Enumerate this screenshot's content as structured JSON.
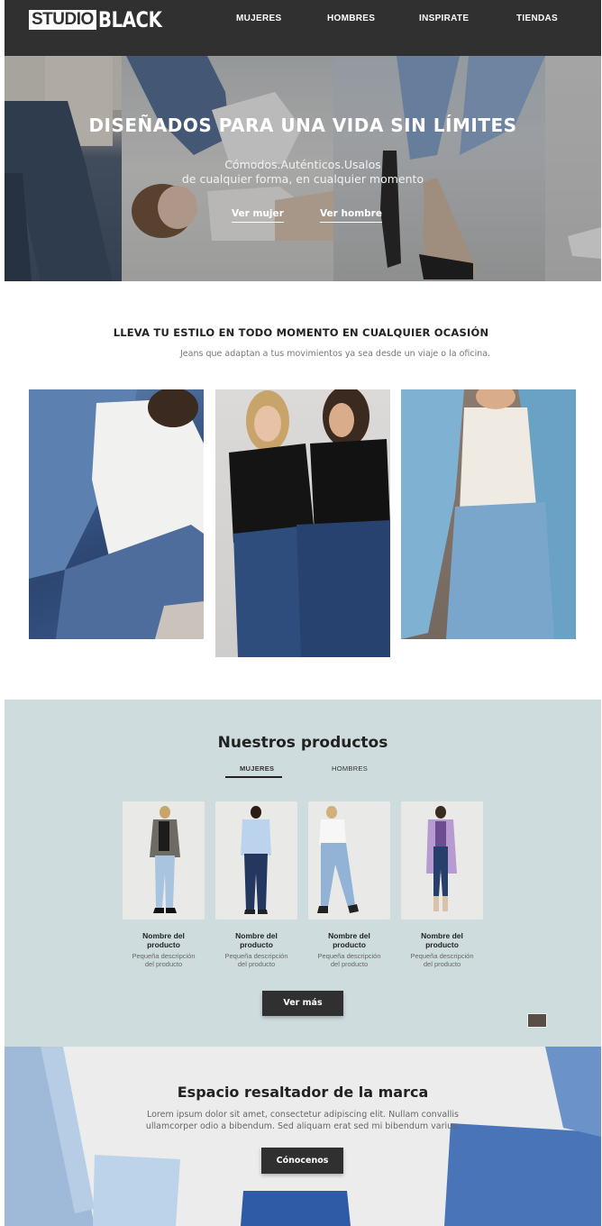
{
  "header": {
    "logo_boxed": "STUDIO",
    "logo_text": "BLACK",
    "nav": [
      "MUJERES",
      "HOMBRES",
      "INSPIRATE",
      "TIENDAS"
    ]
  },
  "hero": {
    "title": "DISEÑADOS PARA UNA VIDA SIN LÍMITES",
    "subtitle_line1": "Cómodos.Auténticos.Usalos",
    "subtitle_line2": "de cualquier forma, en cualquier momento",
    "link_women": "Ver mujer",
    "link_men": "Ver hombre"
  },
  "style": {
    "title": "LLEVA TU ESTILO EN TODO MOMENTO EN CUALQUIER OCASIÓN",
    "subtitle": "Jeans que adaptan a tus movimientos ya sea desde un viaje o la oficina."
  },
  "products": {
    "title": "Nuestros productos",
    "tabs": [
      "MUJERES",
      "HOMBRES"
    ],
    "active_tab": "MUJERES",
    "items": [
      {
        "name_line1": "Nombre del",
        "name_line2": "producto",
        "desc_line1": "Pequeña descripción",
        "desc_line2": "del producto"
      },
      {
        "name_line1": "Nombre del",
        "name_line2": "producto",
        "desc_line1": "Pequeña descripción",
        "desc_line2": "del producto"
      },
      {
        "name_line1": "Nombre del",
        "name_line2": "producto",
        "desc_line1": "Pequeña descripción",
        "desc_line2": "del producto"
      },
      {
        "name_line1": "Nombre del",
        "name_line2": "producto",
        "desc_line1": "Pequeña descripción",
        "desc_line2": "del producto"
      }
    ],
    "more_button": "Ver más"
  },
  "brand": {
    "title": "Espacio resaltador de la marca",
    "text": "Lorem ipsum dolor sit amet, consectetur adipiscing elit. Nullam convallis ullamcorper odio a bibendum. Sed aliquam erat sed mi bibendum varius.",
    "button": "Cónocenos"
  },
  "colors": {
    "header_bg": "#303030",
    "products_bg": "#cfdcdd",
    "brand_bg": "#ececed",
    "button_bg": "#303030"
  }
}
